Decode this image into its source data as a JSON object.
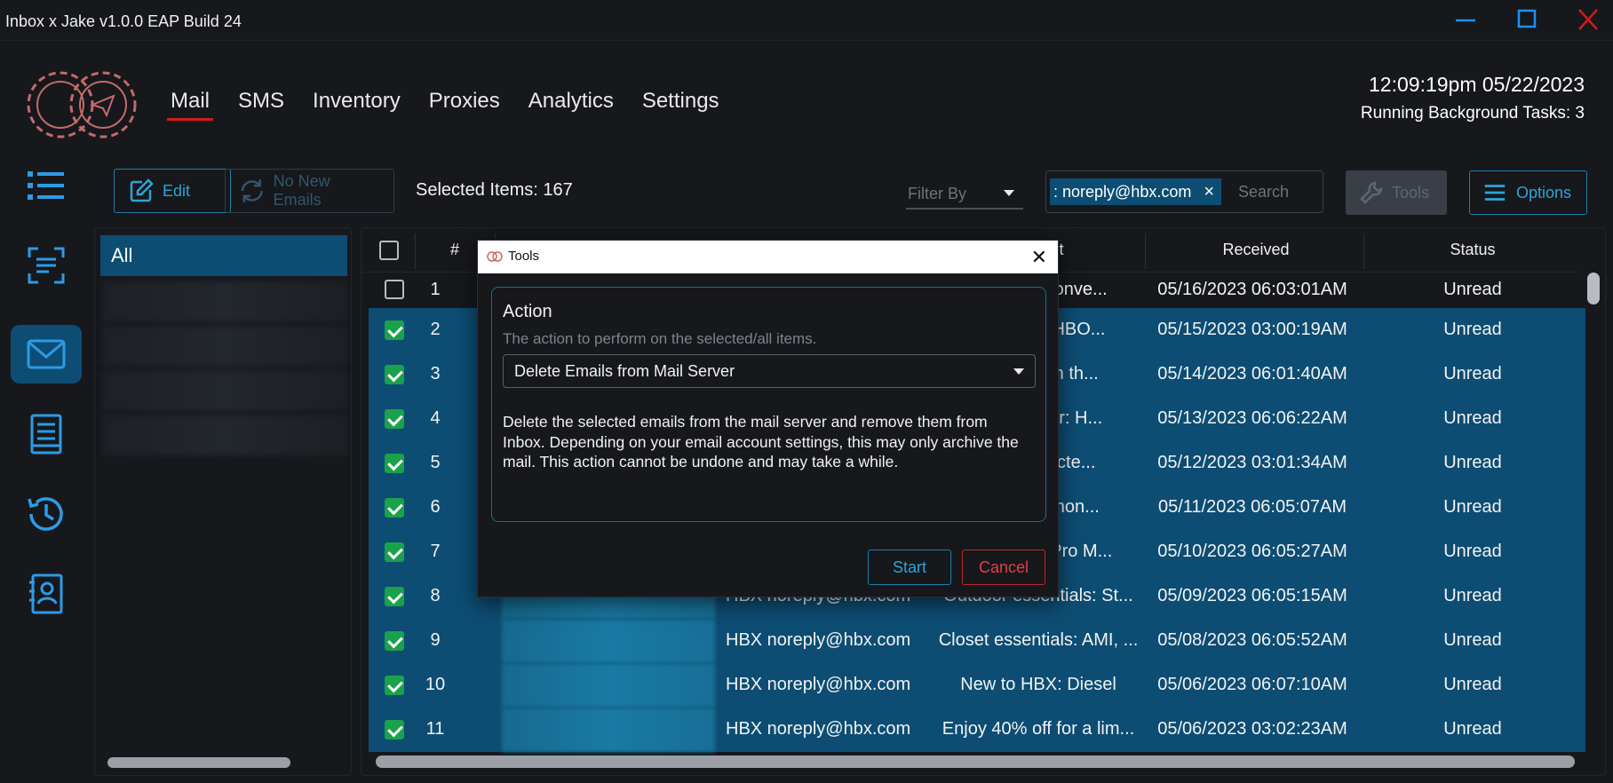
{
  "window": {
    "title": "Inbox x Jake v1.0.0 EAP Build 24"
  },
  "nav": {
    "tabs": [
      "Mail",
      "SMS",
      "Inventory",
      "Proxies",
      "Analytics",
      "Settings"
    ],
    "active": "Mail"
  },
  "clock": {
    "time": "12:09:19pm 05/22/2023",
    "tasks": "Running Background Tasks: 3"
  },
  "toolbar": {
    "edit": "Edit",
    "no_new_emails": "No New Emails",
    "selected_items": "Selected Items: 167",
    "filter_placeholder": "Filter By",
    "search_chip": ": noreply@hbx.com",
    "search_placeholder": "Search",
    "tools": "Tools",
    "options": "Options"
  },
  "accounts": {
    "all": "All"
  },
  "table": {
    "headers": {
      "num": "#",
      "subject_partial": "t",
      "received": "Received",
      "status": "Status"
    },
    "rows": [
      {
        "num": "1",
        "sender": "",
        "subject": "e: Conve...",
        "received": "05/16/2023 06:03:01AM",
        "status": "Unread",
        "checked": false
      },
      {
        "num": "2",
        "sender": "",
        "subject": "EIGHBO...",
        "received": "05/15/2023 03:00:19AM",
        "status": "Unread",
        "checked": true
      },
      {
        "num": "3",
        "sender": "",
        "subject": "ys on th...",
        "received": "05/14/2023 06:01:40AM",
        "status": "Unread",
        "checked": true
      },
      {
        "num": "4",
        "sender": "",
        "subject": "twear: H...",
        "received": "05/13/2023 06:06:22AM",
        "status": "Unread",
        "checked": true
      },
      {
        "num": "5",
        "sender": "",
        "subject": "Selecte...",
        "received": "05/12/2023 03:01:34AM",
        "status": "Unread",
        "checked": true
      },
      {
        "num": "6",
        "sender": "",
        "subject": "w: Anon...",
        "received": "05/11/2023 06:05:07AM",
        "status": "Unread",
        "checked": true
      },
      {
        "num": "7",
        "sender": "",
        "subject": "BX Pro M...",
        "received": "05/10/2023 06:05:27AM",
        "status": "Unread",
        "checked": true
      },
      {
        "num": "8",
        "sender": "HBX noreply@hbx.com",
        "subject": "Outdoor essentials: St...",
        "received": "05/09/2023 06:05:15AM",
        "status": "Unread",
        "checked": true
      },
      {
        "num": "9",
        "sender": "HBX noreply@hbx.com",
        "subject": "Closet essentials: AMI, ...",
        "received": "05/08/2023 06:05:52AM",
        "status": "Unread",
        "checked": true
      },
      {
        "num": "10",
        "sender": "HBX noreply@hbx.com",
        "subject": "New to HBX: Diesel",
        "received": "05/06/2023 06:07:10AM",
        "status": "Unread",
        "checked": true
      },
      {
        "num": "11",
        "sender": "HBX noreply@hbx.com",
        "subject": "Enjoy 40% off for a lim...",
        "received": "05/06/2023 03:02:23AM",
        "status": "Unread",
        "checked": true
      }
    ]
  },
  "dialog": {
    "title": "Tools",
    "action_label": "Action",
    "action_sub": "The action to perform on the selected/all items.",
    "action_value": "Delete Emails from Mail Server",
    "description": "Delete the selected emails from the mail server and remove them from Inbox. Depending on your email account settings, this may only archive the mail. This action cannot be undone and may take a while.",
    "start": "Start",
    "cancel": "Cancel"
  },
  "colors": {
    "accent": "#2ea3d8",
    "selected_row": "#0d4d73",
    "danger": "#d11b1b",
    "checkbox": "#1aa24a"
  }
}
